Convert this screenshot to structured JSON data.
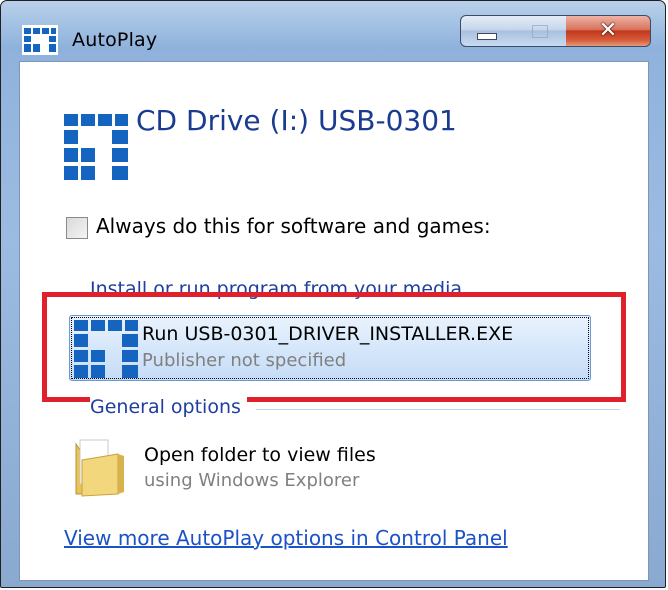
{
  "window": {
    "title": "AutoPlay",
    "icon": "autoplay-logo-icon",
    "controls": {
      "minimize": "minimize-icon",
      "maximize": "maximize-icon",
      "close": "close-icon"
    }
  },
  "drive": {
    "title": "CD Drive (I:) USB-0301",
    "icon": "drive-logo-icon"
  },
  "always": {
    "label": "Always do this for software and games:",
    "checked": false
  },
  "install_section": {
    "label": "Install or run program from your media",
    "options": [
      {
        "title": "Run USB-0301_DRIVER_INSTALLER.EXE",
        "subtitle": "Publisher not specified",
        "icon": "program-logo-icon"
      }
    ]
  },
  "general_section": {
    "label": "General options",
    "options": [
      {
        "title": "Open folder to view files",
        "subtitle": "using Windows Explorer",
        "icon": "folder-icon"
      }
    ]
  },
  "control_panel_link": "View more AutoPlay options in Control Panel",
  "colors": {
    "highlight": "#e0202a",
    "link": "#1b52c7",
    "section": "#1e3fa0",
    "drive_title": "#1a3b8f"
  }
}
